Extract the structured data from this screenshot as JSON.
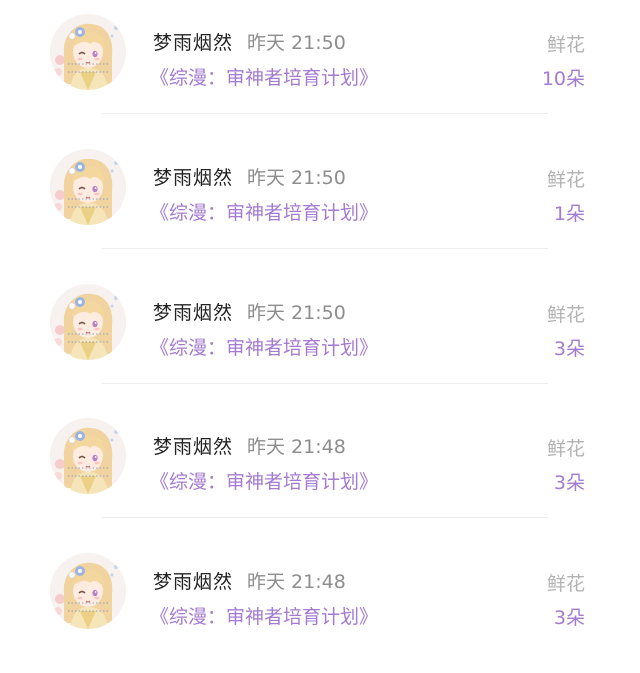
{
  "records": [
    {
      "user": "梦雨烟然",
      "time": "昨天 21:50",
      "book": "《综漫：审神者培育计划》",
      "gift_type": "鲜花",
      "gift_count": "10朵"
    },
    {
      "user": "梦雨烟然",
      "time": "昨天 21:50",
      "book": "《综漫：审神者培育计划》",
      "gift_type": "鲜花",
      "gift_count": "1朵"
    },
    {
      "user": "梦雨烟然",
      "time": "昨天 21:50",
      "book": "《综漫：审神者培育计划》",
      "gift_type": "鲜花",
      "gift_count": "3朵"
    },
    {
      "user": "梦雨烟然",
      "time": "昨天 21:48",
      "book": "《综漫：审神者培育计划》",
      "gift_type": "鲜花",
      "gift_count": "3朵"
    },
    {
      "user": "梦雨烟然",
      "time": "昨天 21:48",
      "book": "《综漫：审神者培育计划》",
      "gift_type": "鲜花",
      "gift_count": "3朵"
    }
  ],
  "colors": {
    "accent": "#a47bd0",
    "name": "#222222",
    "muted": "#8d8d8d",
    "gift_type": "#b3b3b3",
    "divider": "#eeeeee"
  },
  "icons": {
    "avatar": "anime-girl-avatar"
  }
}
